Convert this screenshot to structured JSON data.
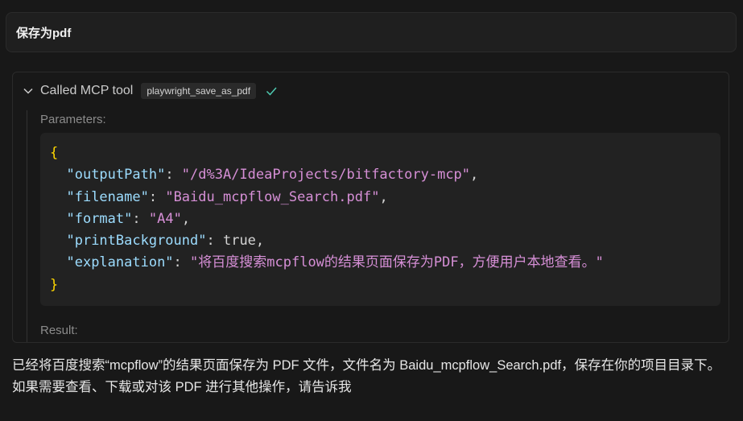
{
  "user_message": "保存为pdf",
  "tool_call": {
    "header": "Called MCP tool",
    "tool_name": "playwright_save_as_pdf",
    "status_icon": "check-icon",
    "parameters_label": "Parameters:",
    "code": {
      "open": "{",
      "lines": [
        {
          "key": "\"outputPath\"",
          "sep": ": ",
          "value": "\"/d%3A/IdeaProjects/bitfactory-mcp\"",
          "tail": ","
        },
        {
          "key": "\"filename\"",
          "sep": ": ",
          "value": "\"Baidu_mcpflow_Search.pdf\"",
          "tail": ","
        },
        {
          "key": "\"format\"",
          "sep": ": ",
          "value": "\"A4\"",
          "tail": ","
        },
        {
          "key": "\"printBackground\"",
          "sep": ": ",
          "value": "true",
          "tail": ","
        },
        {
          "key": "\"explanation\"",
          "sep": ": ",
          "value": "\"将百度搜索mcpflow的结果页面保存为PDF，方便用户本地查看。\"",
          "tail": ""
        }
      ],
      "close": "}"
    },
    "result_label": "Result:"
  },
  "assistant_message": "已经将百度搜索“mcpflow”的结果页面保存为 PDF 文件，文件名为 Baidu_mcpflow_Search.pdf，保存在你的项目目录下。如果需要查看、下载或对该 PDF 进行其他操作，请告诉我",
  "colors": {
    "background": "#181818",
    "brace": "#ffd700",
    "key": "#9cdcfe",
    "string": "#ce9178",
    "check": "#4ec9b0"
  }
}
